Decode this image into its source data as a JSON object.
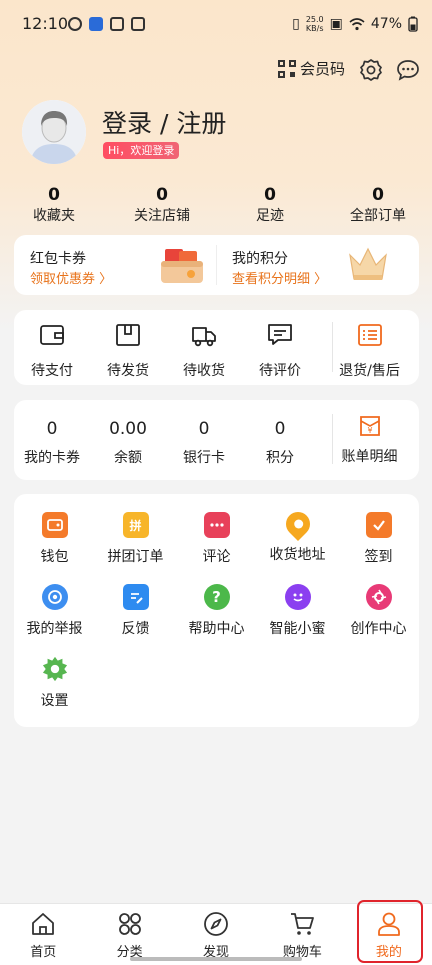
{
  "status": {
    "time": "12:10",
    "net_speed_value": "25.0",
    "net_speed_unit": "KB/s",
    "battery": "47%"
  },
  "topbar": {
    "member_code": "会员码"
  },
  "profile": {
    "title": "登录 / 注册",
    "welcome": "Hi，欢迎登录"
  },
  "stats": [
    {
      "num": "0",
      "label": "收藏夹"
    },
    {
      "num": "0",
      "label": "关注店铺"
    },
    {
      "num": "0",
      "label": "足迹"
    },
    {
      "num": "0",
      "label": "全部订单"
    }
  ],
  "promo": {
    "coupons": {
      "title": "红包卡券",
      "link": "领取优惠券 〉"
    },
    "points": {
      "title": "我的积分",
      "link": "查看积分明细 〉"
    }
  },
  "orders": [
    {
      "label": "待支付",
      "icon": "wallet-icon"
    },
    {
      "label": "待发货",
      "icon": "box-icon"
    },
    {
      "label": "待收货",
      "icon": "truck-icon"
    },
    {
      "label": "待评价",
      "icon": "comment-icon"
    },
    {
      "label": "退货/售后",
      "icon": "refund-list-icon"
    }
  ],
  "wallet": [
    {
      "num": "0",
      "label": "我的卡券"
    },
    {
      "num": "0.00",
      "label": "余额"
    },
    {
      "num": "0",
      "label": "银行卡"
    },
    {
      "num": "0",
      "label": "积分"
    },
    {
      "label": "账单明细",
      "icon": "bill-icon"
    }
  ],
  "tools": [
    {
      "label": "钱包",
      "icon": "wallet-icon",
      "color": "#f47a2a"
    },
    {
      "label": "拼团订单",
      "icon": "group-bag-icon",
      "color": "#f7b52a",
      "glyph": "拼"
    },
    {
      "label": "评论",
      "icon": "chat-icon",
      "color": "#e8415a"
    },
    {
      "label": "收货地址",
      "icon": "location-icon",
      "color": "#f6a81f"
    },
    {
      "label": "签到",
      "icon": "calendar-check-icon",
      "color": "#f47a2a"
    },
    {
      "label": "我的举报",
      "icon": "target-icon",
      "color": "#3d8ef0"
    },
    {
      "label": "反馈",
      "icon": "document-edit-icon",
      "color": "#2e8bf0"
    },
    {
      "label": "帮助中心",
      "icon": "question-icon",
      "color": "#4cb84a",
      "glyph": "?"
    },
    {
      "label": "智能小蜜",
      "icon": "assistant-icon",
      "color": "#8b3ff0"
    },
    {
      "label": "创作中心",
      "icon": "camera-shutter-icon",
      "color": "#e83a76"
    },
    {
      "label": "设置",
      "icon": "gear-icon",
      "color": "#57b650"
    }
  ],
  "tabbar": [
    {
      "label": "首页",
      "icon": "home-icon"
    },
    {
      "label": "分类",
      "icon": "category-icon"
    },
    {
      "label": "发现",
      "icon": "compass-icon"
    },
    {
      "label": "购物车",
      "icon": "cart-icon"
    },
    {
      "label": "我的",
      "icon": "user-icon",
      "active": true
    }
  ],
  "colors": {
    "accent": "#f06a1e",
    "highlight_border": "#e0242c",
    "header_bg": "#fbe6cb"
  }
}
